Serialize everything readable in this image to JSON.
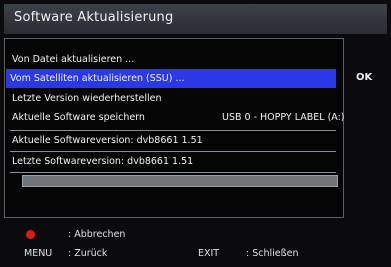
{
  "header": {
    "title": "Software Aktualisierung"
  },
  "menu": {
    "items": [
      {
        "label": "Von Datei aktualisieren ..."
      },
      {
        "label": "Vom Satelliten aktualisieren (SSU) ..."
      },
      {
        "label": "Letzte Version wiederherstellen"
      },
      {
        "label": "Aktuelle Software speichern",
        "value": "USB 0 - HOPPY LABEL (A:)"
      }
    ],
    "selected_index": 1,
    "current_version": "Aktuelle Softwareversion: dvb8661 1.51",
    "last_version": "Letzte Softwareversion: dvb8661 1.51",
    "progress_percent": 0
  },
  "side": {
    "ok_label": "OK"
  },
  "footer": {
    "red_key_action": ": Abbrechen",
    "menu_key": "MENU",
    "menu_action": ": Zurück",
    "exit_key": "EXIT",
    "exit_action": ": Schließen"
  },
  "colors": {
    "selection": "#2b38e8",
    "red_key": "#e01818"
  }
}
